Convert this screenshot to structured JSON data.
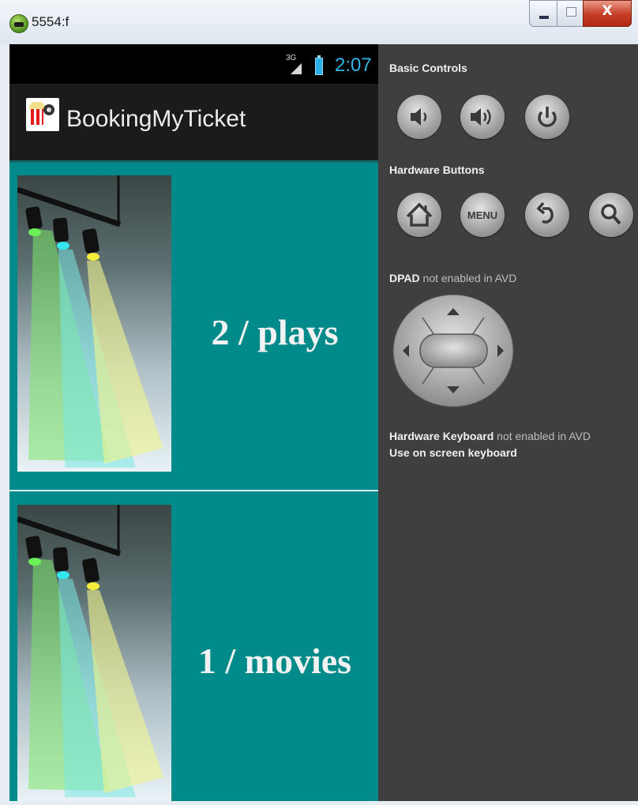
{
  "window": {
    "title": "5554:f",
    "close_glyph": "X"
  },
  "phone": {
    "status": {
      "network": "3G",
      "time": "2:07"
    },
    "action_bar": {
      "app_name": "BookingMyTicket"
    },
    "items": [
      {
        "label": "2 / plays"
      },
      {
        "label": "1 / movies"
      }
    ]
  },
  "controls": {
    "basic_controls_label": "Basic Controls",
    "hardware_buttons_label": "Hardware Buttons",
    "menu_label": "MENU",
    "dpad_label": "DPAD",
    "dpad_status": "not enabled in AVD",
    "keyboard_label": "Hardware Keyboard",
    "keyboard_status": "not enabled in AVD",
    "keyboard_hint": "Use on screen keyboard"
  },
  "icons": {
    "basic": [
      "volume-down-icon",
      "volume-up-icon",
      "power-icon"
    ],
    "hardware": [
      "home-icon",
      "menu-icon",
      "back-icon",
      "search-icon"
    ]
  }
}
